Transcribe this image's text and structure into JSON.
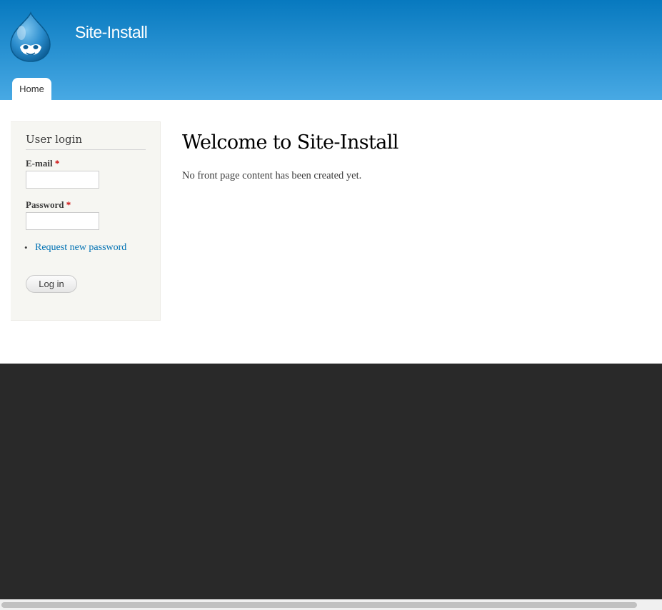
{
  "header": {
    "site_name": "Site-Install",
    "tabs": [
      {
        "label": "Home"
      }
    ]
  },
  "sidebar": {
    "block_title": "User login",
    "email": {
      "label": "E-mail",
      "required_mark": "*",
      "value": ""
    },
    "password": {
      "label": "Password",
      "required_mark": "*",
      "value": ""
    },
    "links": [
      {
        "label": "Request new password"
      }
    ],
    "submit_label": "Log in"
  },
  "main": {
    "title": "Welcome to Site-Install",
    "body": "No front page content has been created yet."
  },
  "icons": {
    "logo": "drupal-drop-logo-icon"
  },
  "colors": {
    "header_top": "#0779bf",
    "header_bottom": "#48a9e4",
    "link": "#0071b3",
    "footer": "#292929",
    "required": "#cc0000"
  }
}
